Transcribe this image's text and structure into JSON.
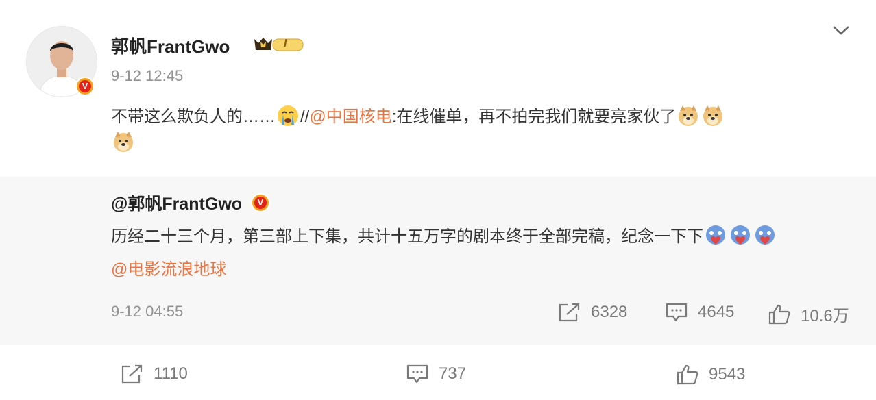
{
  "post": {
    "author": "郭帆FrantGwo",
    "time": "9-12 12:45",
    "text_before": "不带这么欺负人的……",
    "text_sep": "//",
    "mention": "@中国核电",
    "text_after": ":在线催单，再不拍完我们就要亮家伙了",
    "emoji_names": [
      "crying-emoji",
      "doge-emoji",
      "doge-emoji",
      "doge-emoji"
    ],
    "vip_level": "I",
    "badge_mark": "V"
  },
  "repost": {
    "author": "@郭帆FrantGwo",
    "badge_mark": "V",
    "text": "历经二十三个月，第三部上下集，共计十五万字的剧本终于全部完稿，纪念一下下",
    "mention": "@电影流浪地球",
    "time": "9-12 04:55",
    "shares": "6328",
    "comments": "4645",
    "likes": "10.6万",
    "emoji_names": [
      "heart-hug-emoji",
      "heart-hug-emoji",
      "heart-hug-emoji"
    ]
  },
  "footer": {
    "shares": "1110",
    "comments": "737",
    "likes": "9543"
  },
  "colors": {
    "link": "#eb7340",
    "meta": "#939393",
    "repost_bg": "#f7f7f7",
    "badge_red": "#e2231a",
    "badge_gold": "#f7a21b"
  },
  "icons": {
    "menu": "chevron-down-icon",
    "share": "share-icon",
    "comment": "comment-icon",
    "like": "thumbs-up-icon"
  }
}
